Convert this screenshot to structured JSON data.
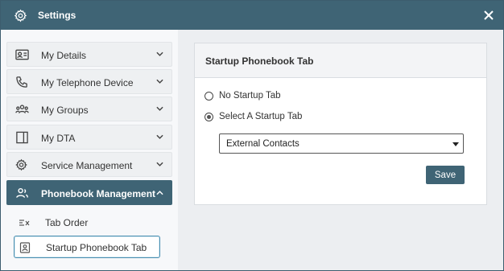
{
  "window": {
    "title": "Settings"
  },
  "sidebar": {
    "items": [
      {
        "label": "My Details",
        "icon": "id-card-icon"
      },
      {
        "label": "My Telephone Device",
        "icon": "phone-icon"
      },
      {
        "label": "My Groups",
        "icon": "users-group-icon"
      },
      {
        "label": "My DTA",
        "icon": "panel-icon"
      },
      {
        "label": "Service Management",
        "icon": "gear-cog-icon"
      },
      {
        "label": "Phonebook Management",
        "icon": "contacts-icon"
      }
    ],
    "subitems": [
      {
        "label": "Tab Order",
        "icon": "sort-list-icon"
      },
      {
        "label": "Startup Phonebook Tab",
        "icon": "contact-card-icon"
      }
    ]
  },
  "panel": {
    "title": "Startup Phonebook Tab",
    "options": [
      {
        "label": "No Startup Tab",
        "checked": false
      },
      {
        "label": "Select A Startup Tab",
        "checked": true
      }
    ],
    "select_value": "External Contacts",
    "save_label": "Save"
  },
  "colors": {
    "accent": "#3f6475",
    "background": "#eceef1"
  }
}
